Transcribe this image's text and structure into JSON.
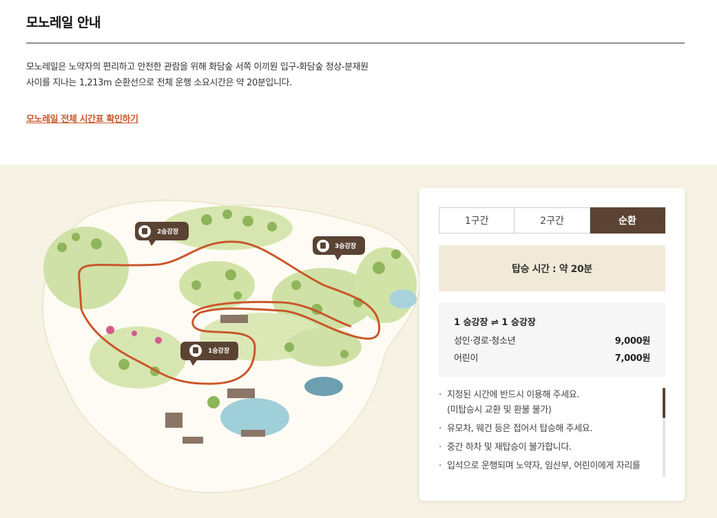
{
  "header": {
    "title": "모노레일 안내",
    "description_line1": "모노레일은 노약자의 편리하고 안전한 관람을 위해 화담숲 서쪽 이끼원 입구-화담숲 정상-분재원",
    "description_line2": "사이를 지나는 1,213m 순환선으로 전체 운행 소요시간은 약 20분입니다.",
    "timetable_link": "모노레일 전체 시간표 확인하기"
  },
  "map": {
    "stations": [
      {
        "label": "1승강장"
      },
      {
        "label": "2승강장"
      },
      {
        "label": "3승강장"
      }
    ],
    "route_color": "#c9562a",
    "marker_color": "#5a4333"
  },
  "panel": {
    "tabs": [
      {
        "label": "1구간",
        "active": false
      },
      {
        "label": "2구간",
        "active": false
      },
      {
        "label": "순환",
        "active": true
      }
    ],
    "ride_time": "탑승 시간 : 약 20분",
    "route": "1 승강장  ⇌  1 승강장",
    "fares": [
      {
        "category": "성인·경로·청소년",
        "price": "9,000원"
      },
      {
        "category": "어린이",
        "price": "7,000원"
      }
    ],
    "notes": [
      {
        "text": "지정된 시간에 반드시 이용해 주세요.",
        "sub": "(미탑승시 교환 및 환불 불가)"
      },
      {
        "text": "유모차, 웨건 등은 접어서 탑승해 주세요.",
        "sub": ""
      },
      {
        "text": "중간 하차 및 재탑승이 불가합니다.",
        "sub": ""
      },
      {
        "text": "입석으로 운행되며 노약자, 임산부, 어린이에게 자리를",
        "sub": ""
      }
    ]
  },
  "colors": {
    "accent": "#c9562a",
    "brown": "#5a4333",
    "beige": "#f2ead8",
    "section_bg": "#f7f3e4"
  }
}
